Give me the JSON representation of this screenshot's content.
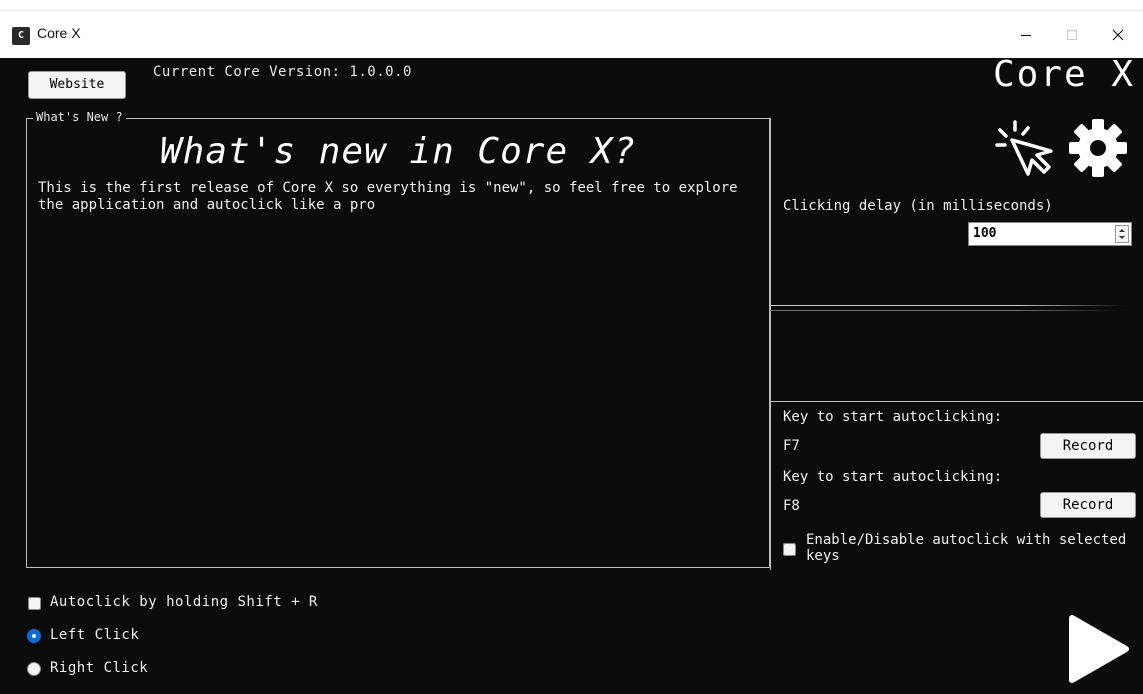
{
  "window": {
    "title": "Core X",
    "icon_glyph": "C"
  },
  "header": {
    "website_label": "Website",
    "version_text": "Current Core Version: 1.0.0.0",
    "brand_title": "Core X"
  },
  "whats_new": {
    "legend": "What's New ?",
    "heading": "What's new in Core X?",
    "body": "This is the first release of Core X so everything is \"new\", so feel free to explore the application and autoclick like a pro"
  },
  "icons": {
    "cursor": "cursor-click-icon",
    "settings": "gear-icon",
    "play": "play-icon"
  },
  "delay": {
    "label": "Clicking delay (in milliseconds)",
    "value": "100"
  },
  "keys": [
    {
      "label": "Key to start autoclicking:",
      "value": "F7",
      "button": "Record"
    },
    {
      "label": "Key to start autoclicking:",
      "value": "F8",
      "button": "Record"
    }
  ],
  "enable_toggle": {
    "label": "Enable/Disable autoclick with selected keys",
    "checked": false
  },
  "options": {
    "shift_r_label": "Autoclick by holding Shift + R",
    "shift_r_checked": false,
    "left_click_label": "Left Click",
    "right_click_label": "Right Click",
    "selected": "left"
  },
  "colors": {
    "background": "#0b0b0b",
    "accent": "#0a6cd6",
    "text": "#f0f0f0"
  }
}
